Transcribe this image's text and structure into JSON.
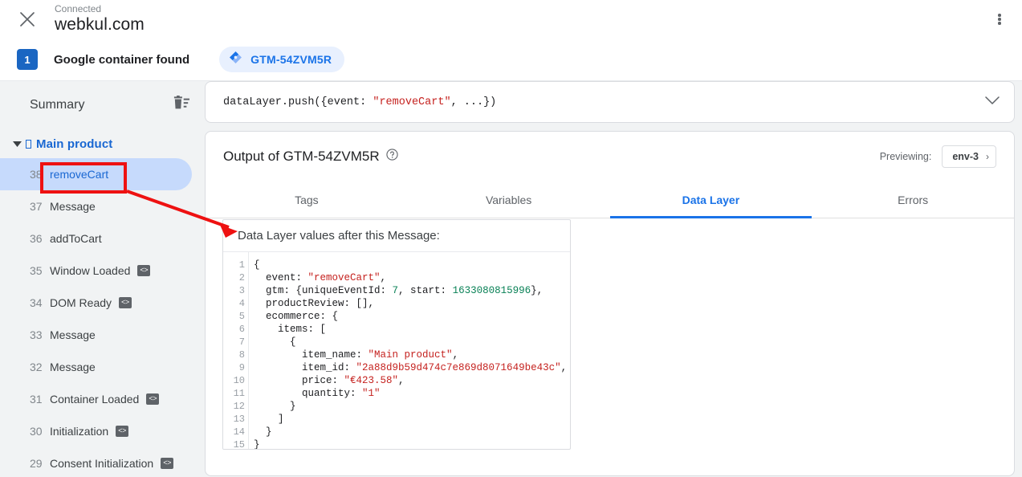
{
  "topbar": {
    "close_icon": "close-icon",
    "connected_label": "Connected",
    "domain": "webkul.com",
    "menu_icon": "more-vert-icon"
  },
  "container_bar": {
    "count": "1",
    "message": "Google container found",
    "chip_label": "GTM-54ZVM5R",
    "chip_icon": "gtm-logo-icon"
  },
  "sidebar": {
    "title": "Summary",
    "clear_icon": "delete-sweep-icon",
    "group": {
      "caret_icon": "caret-down-icon",
      "label": "Main product",
      "prefix_glyph": "\u0001"
    },
    "items": [
      {
        "num": "38",
        "label": "removeCart",
        "active": true,
        "badge": ""
      },
      {
        "num": "37",
        "label": "Message",
        "active": false,
        "badge": ""
      },
      {
        "num": "36",
        "label": "addToCart",
        "active": false,
        "badge": ""
      },
      {
        "num": "35",
        "label": "Window Loaded",
        "active": false,
        "badge": "<>"
      },
      {
        "num": "34",
        "label": "DOM Ready",
        "active": false,
        "badge": "<>"
      },
      {
        "num": "33",
        "label": "Message",
        "active": false,
        "badge": ""
      },
      {
        "num": "32",
        "label": "Message",
        "active": false,
        "badge": ""
      },
      {
        "num": "31",
        "label": "Container Loaded",
        "active": false,
        "badge": "<>"
      },
      {
        "num": "30",
        "label": "Initialization",
        "active": false,
        "badge": "<>"
      },
      {
        "num": "29",
        "label": "Consent Initialization",
        "active": false,
        "badge": "<>"
      }
    ]
  },
  "push_card": {
    "prefix": "dataLayer.push({event: ",
    "event_string": "\"removeCart\"",
    "suffix": ", ...})",
    "collapse_icon": "chevron-down-icon"
  },
  "output": {
    "title": "Output of GTM-54ZVM5R",
    "help_icon": "help-circle-icon",
    "previewing_label": "Previewing:",
    "env_value": "env-3",
    "env_chevron": "chevron-right-icon",
    "tabs": [
      {
        "label": "Tags",
        "active": false
      },
      {
        "label": "Variables",
        "active": false
      },
      {
        "label": "Data Layer",
        "active": true
      },
      {
        "label": "Errors",
        "active": false
      }
    ]
  },
  "data_layer_panel": {
    "heading": "Data Layer values after this Message:",
    "line_numbers": [
      "1",
      "2",
      "3",
      "4",
      "5",
      "6",
      "7",
      "8",
      "9",
      "10",
      "11",
      "12",
      "13",
      "14",
      "15"
    ],
    "lines": [
      {
        "n": 1,
        "segments": [
          {
            "t": "{",
            "k": "plain"
          }
        ]
      },
      {
        "n": 2,
        "segments": [
          {
            "t": "  event: ",
            "k": "plain"
          },
          {
            "t": "\"removeCart\"",
            "k": "str"
          },
          {
            "t": ",",
            "k": "plain"
          }
        ]
      },
      {
        "n": 3,
        "segments": [
          {
            "t": "  gtm: {uniqueEventId: ",
            "k": "plain"
          },
          {
            "t": "7",
            "k": "num"
          },
          {
            "t": ", start: ",
            "k": "plain"
          },
          {
            "t": "1633080815996",
            "k": "num"
          },
          {
            "t": "},",
            "k": "plain"
          }
        ]
      },
      {
        "n": 4,
        "segments": [
          {
            "t": "  productReview: [],",
            "k": "plain"
          }
        ]
      },
      {
        "n": 5,
        "segments": [
          {
            "t": "  ecommerce: {",
            "k": "plain"
          }
        ]
      },
      {
        "n": 6,
        "segments": [
          {
            "t": "    items: [",
            "k": "plain"
          }
        ]
      },
      {
        "n": 7,
        "segments": [
          {
            "t": "      {",
            "k": "plain"
          }
        ]
      },
      {
        "n": 8,
        "segments": [
          {
            "t": "        item_name: ",
            "k": "plain"
          },
          {
            "t": "\"Main product\"",
            "k": "str"
          },
          {
            "t": ",",
            "k": "plain"
          }
        ]
      },
      {
        "n": 9,
        "segments": [
          {
            "t": "        item_id: ",
            "k": "plain"
          },
          {
            "t": "\"2a88d9b59d474c7e869d8071649be43c\"",
            "k": "str"
          },
          {
            "t": ",",
            "k": "plain"
          }
        ]
      },
      {
        "n": 10,
        "segments": [
          {
            "t": "        price: ",
            "k": "plain"
          },
          {
            "t": "\"€423.58\"",
            "k": "str"
          },
          {
            "t": ",",
            "k": "plain"
          }
        ]
      },
      {
        "n": 11,
        "segments": [
          {
            "t": "        quantity: ",
            "k": "plain"
          },
          {
            "t": "\"1\"",
            "k": "str"
          }
        ]
      },
      {
        "n": 12,
        "segments": [
          {
            "t": "      }",
            "k": "plain"
          }
        ]
      },
      {
        "n": 13,
        "segments": [
          {
            "t": "    ]",
            "k": "plain"
          }
        ]
      },
      {
        "n": 14,
        "segments": [
          {
            "t": "  }",
            "k": "plain"
          }
        ]
      },
      {
        "n": 15,
        "segments": [
          {
            "t": "}",
            "k": "plain"
          }
        ]
      }
    ]
  },
  "annotation": {
    "color": "#ee1111",
    "highlight_target": "removeCart",
    "arrow_points_to": "Data Layer values after this Message:"
  },
  "colors": {
    "accent_blue": "#1a73e8",
    "group_blue": "#1967d2",
    "active_row": "#c6dafc",
    "sidebar_bg": "#f1f3f4",
    "string_red": "#c5221f",
    "number_green": "#098156",
    "badge_blue": "#1a66c2",
    "annotation_red": "#ee1111"
  }
}
